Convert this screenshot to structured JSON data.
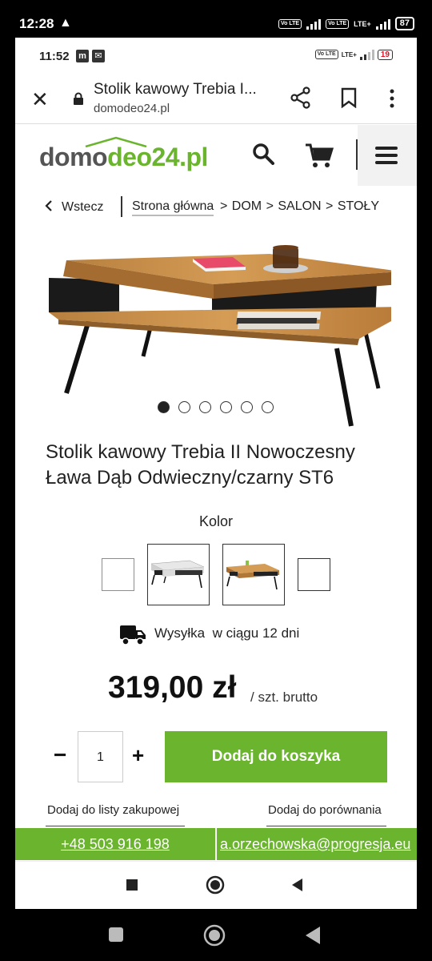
{
  "outer_status": {
    "time": "12:28",
    "warning": "▲",
    "volte1": "Vo LTE",
    "volte2": "Vo LTE",
    "lte": "LTE+",
    "battery": "87"
  },
  "inner_status": {
    "time": "11:52",
    "icon1": "m",
    "icon2": "✉",
    "volte": "Vo LTE",
    "lte": "LTE+",
    "battery": "19"
  },
  "browser": {
    "tab_title": "Stolik kawowy Trebia I...",
    "url": "domodeo24.pl"
  },
  "site": {
    "logo_part1": "domo",
    "logo_part2": "deo24.pl"
  },
  "breadcrumb": {
    "back": "Wstecz",
    "home": "Strona główna",
    "rest": "> DOM > SALON > STOŁY"
  },
  "product": {
    "title": "Stolik kawowy Trebia II Nowoczesny Ława Dąb Odwieczny/czarny ST6",
    "color_label": "Kolor",
    "shipping": "Wysyłka  w ciągu 12 dni",
    "price": "319,00 zł",
    "unit": "/ szt. brutto",
    "quantity": "1",
    "qty_minus": "−",
    "qty_plus": "+",
    "add_to_cart": "Dodaj do koszyka",
    "add_to_list": "Dodaj do listy zakupowej",
    "add_to_compare": "Dodaj do porównania",
    "image_index": 1,
    "image_count": 6
  },
  "contact": {
    "phone": "+48 503 916 198",
    "email": "a.orzechowska@progresja.eu"
  },
  "colors": {
    "brand_green": "#6ab42e",
    "swatch_selected": "#4aa7b8"
  }
}
